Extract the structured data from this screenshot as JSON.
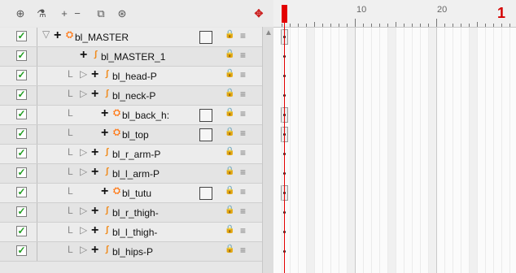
{
  "toolbar": {
    "icons": [
      "infinity-view-icon",
      "magic-wand-icon",
      "add-layer-icon",
      "remove-layer-icon",
      "group-layers-icon",
      "add-peg-icon"
    ],
    "symbols": [
      "⊕",
      "⚗",
      "+",
      "−",
      "⧉",
      "⊛"
    ],
    "timeline_mode_symbol": "✥"
  },
  "timeline": {
    "ruler_labels": [
      "10",
      "20"
    ],
    "end_marker": "1"
  },
  "layers": [
    {
      "name": "bl_MASTER",
      "type": "peg",
      "checked": true,
      "depth": 0,
      "swatch": true
    },
    {
      "name": "bl_MASTER_1",
      "type": "drawing",
      "checked": true,
      "depth": 1,
      "swatch": false
    },
    {
      "name": "bl_head-P",
      "type": "drawing",
      "checked": true,
      "depth": 2,
      "swatch": false
    },
    {
      "name": "bl_neck-P",
      "type": "drawing",
      "checked": true,
      "depth": 2,
      "swatch": false
    },
    {
      "name": "bl_back_h:",
      "type": "peg",
      "checked": true,
      "depth": 2,
      "swatch": true
    },
    {
      "name": "bl_top",
      "type": "peg",
      "checked": true,
      "depth": 2,
      "swatch": true
    },
    {
      "name": "bl_r_arm-P",
      "type": "drawing",
      "checked": true,
      "depth": 2,
      "swatch": false
    },
    {
      "name": "bl_l_arm-P",
      "type": "drawing",
      "checked": true,
      "depth": 2,
      "swatch": false
    },
    {
      "name": "bl_tutu",
      "type": "peg",
      "checked": true,
      "depth": 2,
      "swatch": true
    },
    {
      "name": "bl_r_thigh-",
      "type": "drawing",
      "checked": true,
      "depth": 2,
      "swatch": false
    },
    {
      "name": "bl_l_thigh-",
      "type": "drawing",
      "checked": true,
      "depth": 2,
      "swatch": false
    },
    {
      "name": "bl_hips-P",
      "type": "drawing",
      "checked": true,
      "depth": 2,
      "swatch": false
    }
  ],
  "colors": {
    "accent_red": "#e30000",
    "check_green": "#1d9b1d",
    "peg_orange": "#ff7a18"
  }
}
